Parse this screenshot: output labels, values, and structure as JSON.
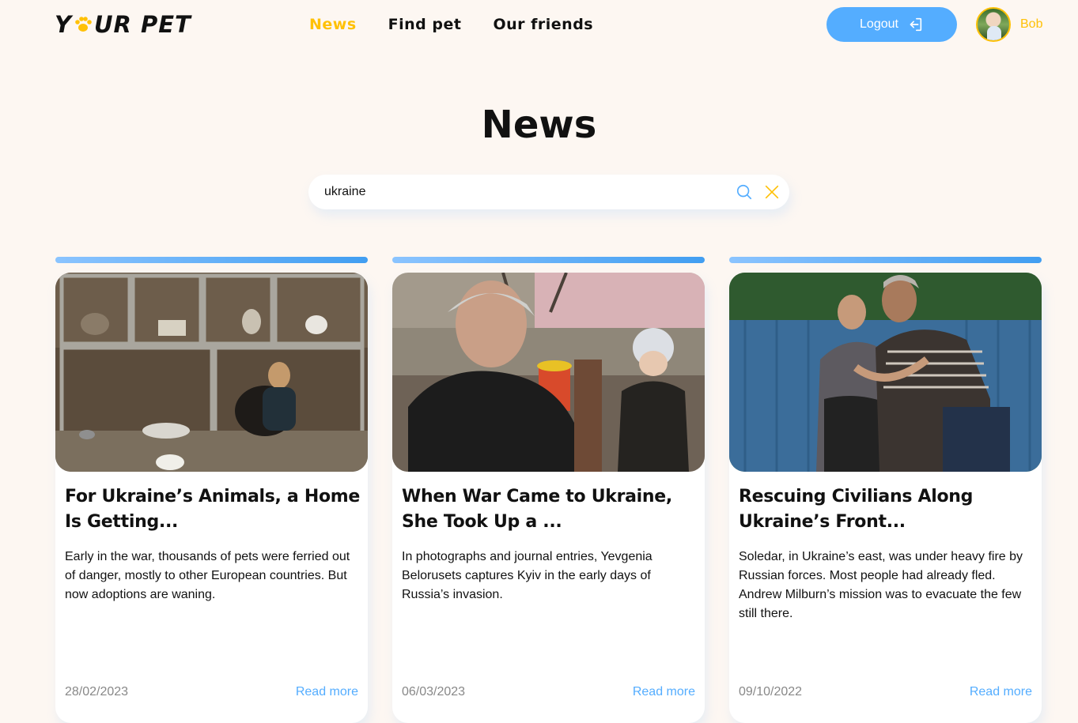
{
  "header": {
    "logo_text_left": "Y",
    "logo_text_right": "UR PET",
    "nav": [
      {
        "label": "News",
        "active": true
      },
      {
        "label": "Find pet",
        "active": false
      },
      {
        "label": "Our friends",
        "active": false
      }
    ],
    "logout_label": "Logout",
    "username": "Bob"
  },
  "page_title": "News",
  "search": {
    "value": "ukraine",
    "placeholder": "Search"
  },
  "news": [
    {
      "title": "For Ukraine’s Animals, a Home Is Getting...",
      "text": "Early in the war, thousands of pets were ferried out of danger, mostly to other European countries. But now adoptions are waning.",
      "date": "28/02/2023",
      "link": "Read more"
    },
    {
      "title": "When War Came to Ukraine, She Took Up a ...",
      "text": "In photographs and journal entries, Yevgenia Belorusets captures Kyiv in the early days of Russia’s invasion.",
      "date": "06/03/2023",
      "link": "Read more"
    },
    {
      "title": "Rescuing Civilians Along Ukraine’s Front...",
      "text": "Soledar, in Ukraine’s east, was under heavy fire by Russian forces. Most people had already fled. Andrew Milburn’s mission was to evacuate the few still there.",
      "date": "09/10/2022",
      "link": "Read more"
    }
  ],
  "colors": {
    "accent_yellow": "#ffc107",
    "accent_blue": "#54adff",
    "background": "#fdf7f2"
  },
  "icons": [
    "paw-icon",
    "logout-icon",
    "search-icon",
    "close-icon"
  ]
}
